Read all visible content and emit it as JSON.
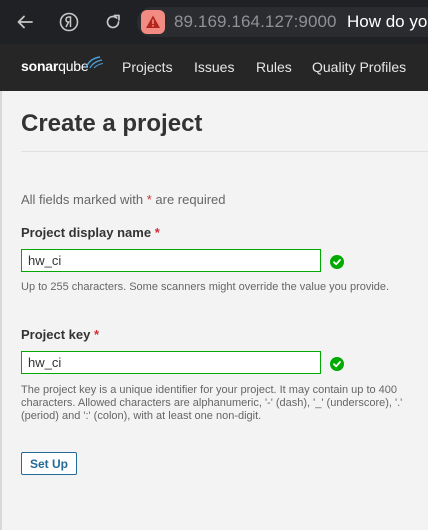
{
  "browser": {
    "url": "89.169.164.127:9000",
    "tab_title": "How do you",
    "icons": [
      "back-arrow-icon",
      "yandex-icon",
      "reload-icon",
      "not-secure-warning-icon"
    ]
  },
  "nav": {
    "logo_bold": "sonar",
    "logo_light": "qube",
    "items": [
      "Projects",
      "Issues",
      "Rules",
      "Quality Profiles"
    ]
  },
  "page": {
    "title": "Create a project",
    "required_note_before": "All fields marked with ",
    "required_star": "*",
    "required_note_after": " are required"
  },
  "form": {
    "display_name_label": "Project display name",
    "display_name_value": "hw_ci",
    "display_name_help": "Up to 255 characters. Some scanners might override the value you provide.",
    "key_label": "Project key",
    "key_value": "hw_ci",
    "key_help": "The project key is a unique identifier for your project. It may contain up to 400 characters. Allowed characters are alphanumeric, '-' (dash), '_' (underscore), '.' (period) and ':' (colon), with at least one non-digit.",
    "submit_label": "Set Up"
  },
  "colors": {
    "valid": "#00aa00",
    "required": "#d02f3a",
    "button": "#236a97",
    "nav_bg": "#262626",
    "browser_bg": "#202124"
  }
}
